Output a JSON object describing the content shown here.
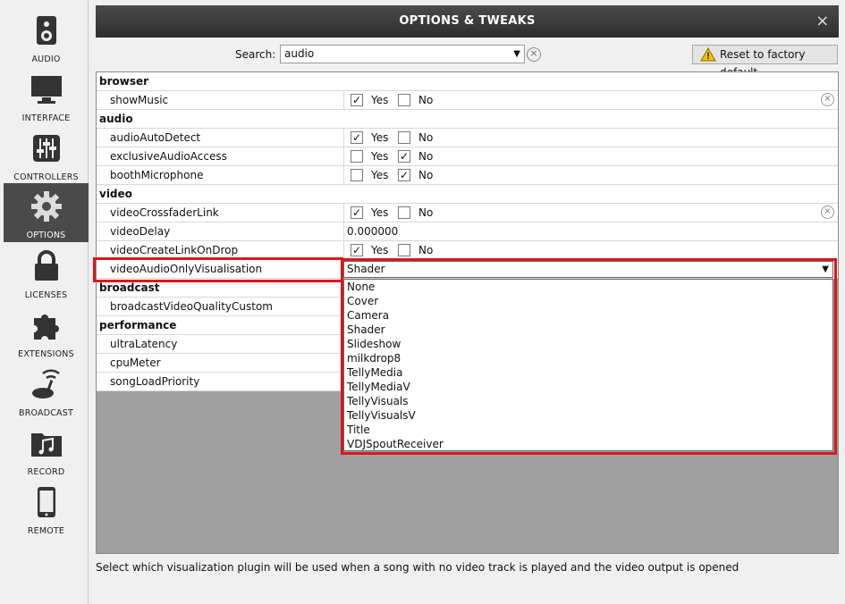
{
  "sidebar": {
    "items": [
      {
        "label": "AUDIO",
        "icon": "speaker-icon"
      },
      {
        "label": "INTERFACE",
        "icon": "monitor-icon"
      },
      {
        "label": "CONTROLLERS",
        "icon": "sliders-icon"
      },
      {
        "label": "OPTIONS",
        "icon": "gear-icon",
        "active": true
      },
      {
        "label": "LICENSES",
        "icon": "lock-icon"
      },
      {
        "label": "EXTENSIONS",
        "icon": "puzzle-icon"
      },
      {
        "label": "BROADCAST",
        "icon": "broadcast-icon"
      },
      {
        "label": "RECORD",
        "icon": "music-folder-icon"
      },
      {
        "label": "REMOTE",
        "icon": "phone-icon"
      }
    ]
  },
  "window": {
    "title": "OPTIONS & TWEAKS",
    "close": "×"
  },
  "search": {
    "label": "Search:",
    "value": "audio",
    "clear": "×"
  },
  "reset": {
    "label": "Reset to factory default"
  },
  "table": {
    "groups": {
      "browser": "browser",
      "audio": "audio",
      "video": "video",
      "broadcast": "broadcast",
      "performance": "performance"
    },
    "rows": {
      "showMusic": "showMusic",
      "audioAutoDetect": "audioAutoDetect",
      "exclusiveAudioAccess": "exclusiveAudioAccess",
      "boothMicrophone": "boothMicrophone",
      "videoCrossfaderLink": "videoCrossfaderLink",
      "videoDelay": "videoDelay",
      "videoDelayValue": "0.000000",
      "videoCreateLinkOnDrop": "videoCreateLinkOnDrop",
      "videoAudioOnlyVisualisation": "videoAudioOnlyVisualisation",
      "broadcastVideoQualityCustom": "broadcastVideoQualityCustom",
      "ultraLatency": "ultraLatency",
      "cpuMeter": "cpuMeter",
      "songLoadPriority": "songLoadPriority"
    },
    "yes": "Yes",
    "no": "No",
    "check": "✓",
    "clear": "×"
  },
  "dropdown": {
    "selected": "Shader",
    "options": [
      "None",
      "Cover",
      "Camera",
      "Shader",
      "Slideshow",
      "milkdrop8",
      "TellyMedia",
      "TellyMediaV",
      "TellyVisuals",
      "TellyVisualsV",
      "Title",
      "VDJSpoutReceiver"
    ]
  },
  "status": "Select which visualization plugin will be used when a song with no video track is played and the video output is opened",
  "colors": {
    "highlight": "#e0141e",
    "active_sidebar": "#4a4a4a",
    "titlebar": "#2e2e2e"
  }
}
